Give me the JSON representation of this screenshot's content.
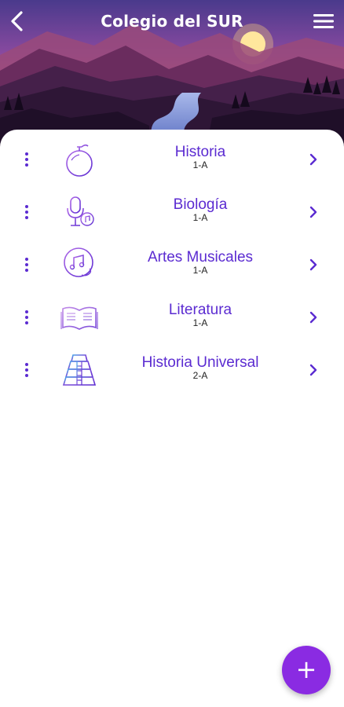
{
  "header": {
    "title": "Colegio del SUR",
    "back_icon": "chevron-left-icon",
    "menu_icon": "hamburger-menu-icon",
    "background_image": "mountain-river-sunset"
  },
  "subjects": [
    {
      "name": "Historia",
      "group": "1-A",
      "icon": "globe-bomb-icon"
    },
    {
      "name": "Biología",
      "group": "1-A",
      "icon": "microphone-music-icon"
    },
    {
      "name": "Artes Musicales",
      "group": "1-A",
      "icon": "music-note-hand-icon"
    },
    {
      "name": "Literatura",
      "group": "1-A",
      "icon": "open-book-icon"
    },
    {
      "name": "Historia Universal",
      "group": "2-A",
      "icon": "pyramid-icon"
    }
  ],
  "fab": {
    "label": "+",
    "icon": "plus-icon"
  },
  "colors": {
    "accent": "#5b2bd1",
    "fab": "#8a2be2",
    "header_dark": "#2b1230"
  }
}
